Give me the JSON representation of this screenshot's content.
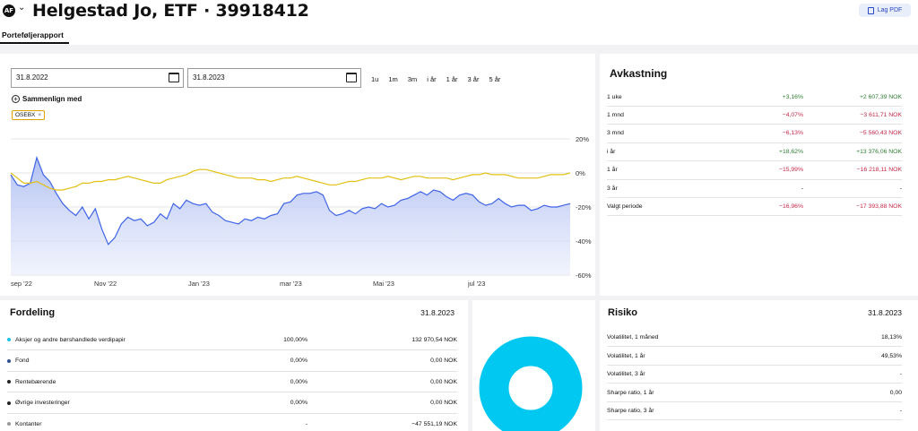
{
  "header": {
    "avatar": "AF",
    "title": "Helgestad Jo, ETF · 39918412",
    "pdf_label": "Lag PDF",
    "tab": "Porteføljerapport"
  },
  "chart": {
    "from_date": "31.8.2022",
    "to_date": "31.8.2023",
    "ranges": [
      "1u",
      "1m",
      "3m",
      "i år",
      "1 år",
      "3 år",
      "5 år"
    ],
    "compare_label": "Sammenlign med",
    "benchmark_chip": "OSEBX"
  },
  "chart_data": {
    "type": "area",
    "x_ticks": [
      "sep '22",
      "Nov '22",
      "Jan '23",
      "mar '23",
      "Mai '23",
      "jul '23"
    ],
    "y_ticks": [
      "20%",
      "0%",
      "-20%",
      "-40%",
      "-60%"
    ],
    "ylim": [
      -60,
      20
    ],
    "grid": true,
    "colors": {
      "portfolio": "#3f64e6",
      "benchmark": "#e2c012"
    },
    "series": [
      {
        "name": "Portefølje",
        "values": [
          -1,
          -7,
          -8,
          -6,
          9,
          -1,
          -5,
          -12,
          -18,
          -22,
          -25,
          -20,
          -27,
          -21,
          -33,
          -42,
          -38,
          -30,
          -26,
          -28,
          -27,
          -31,
          -29,
          -24,
          -27,
          -18,
          -21,
          -16,
          -18,
          -19,
          -18,
          -23,
          -25,
          -28,
          -29,
          -30,
          -27,
          -28,
          -26,
          -27,
          -25,
          -24,
          -18,
          -17,
          -13,
          -12,
          -12,
          -11,
          -13,
          -22,
          -25,
          -24,
          -22,
          -24,
          -21,
          -20,
          -21,
          -18,
          -20,
          -19,
          -16,
          -15,
          -13,
          -11,
          -13,
          -10,
          -11,
          -14,
          -16,
          -13,
          -12,
          -13,
          -17,
          -19,
          -18,
          -15,
          -18,
          -20,
          -19,
          -19,
          -22,
          -21,
          -19,
          -20,
          -20,
          -19,
          -18
        ]
      },
      {
        "name": "OSEBX",
        "values": [
          0,
          -3,
          -6,
          -6,
          -5,
          -7,
          -9,
          -10,
          -10,
          -9,
          -8,
          -6,
          -6,
          -5,
          -5,
          -4,
          -4,
          -3,
          -2,
          -3,
          -4,
          -5,
          -6,
          -6,
          -4,
          -3,
          -2,
          -1,
          1,
          2,
          2,
          1,
          0,
          -1,
          -2,
          -3,
          -3,
          -3,
          -4,
          -4,
          -5,
          -4,
          -3,
          -3,
          -2,
          -3,
          -4,
          -5,
          -6,
          -7,
          -7,
          -6,
          -5,
          -5,
          -4,
          -3,
          -3,
          -3,
          -2,
          -3,
          -4,
          -3,
          -2,
          -2,
          -3,
          -3,
          -3,
          -3,
          -4,
          -3,
          -2,
          -1,
          -1,
          0,
          -1,
          -1,
          -1,
          -2,
          -3,
          -3,
          -3,
          -3,
          -2,
          -1,
          -1,
          -1,
          0
        ]
      }
    ]
  },
  "avkastning": {
    "title": "Avkastning",
    "rows": [
      {
        "label": "1 uke",
        "pct": "+3,16%",
        "nok": "+2 607,39 NOK",
        "trend": "pos"
      },
      {
        "label": "1 mnd",
        "pct": "−4,07%",
        "nok": "−3 611,71 NOK",
        "trend": "neg"
      },
      {
        "label": "3 mnd",
        "pct": "−6,13%",
        "nok": "−5 560,43 NOK",
        "trend": "neg"
      },
      {
        "label": "i år",
        "pct": "+18,62%",
        "nok": "+13 376,06 NOK",
        "trend": "pos"
      },
      {
        "label": "1 år",
        "pct": "−15,99%",
        "nok": "−16 218,11 NOK",
        "trend": "neg"
      },
      {
        "label": "3 år",
        "pct": "-",
        "nok": "-",
        "trend": "none"
      },
      {
        "label": "Valgt periode",
        "pct": "−16,96%",
        "nok": "−17 393,88 NOK",
        "trend": "neg"
      }
    ]
  },
  "fordeling": {
    "title": "Fordeling",
    "date": "31.8.2023",
    "rows": [
      {
        "label": "Aksjer og andre børshandlede verdipapir",
        "pct": "100,00%",
        "nok": "132 970,54 NOK",
        "color": "#19c3ec"
      },
      {
        "label": "Fond",
        "pct": "0,00%",
        "nok": "0,00 NOK",
        "color": "#2f4f8f"
      },
      {
        "label": "Rentebærende",
        "pct": "0,00%",
        "nok": "0,00 NOK",
        "color": "#222222"
      },
      {
        "label": "Øvrige investeringer",
        "pct": "0,00%",
        "nok": "0,00 NOK",
        "color": "#222222"
      },
      {
        "label": "Kontanter",
        "pct": "-",
        "nok": "−47 551,19 NOK",
        "color": "#999999"
      }
    ],
    "donut_color": "#00c8f0"
  },
  "risiko": {
    "title": "Risiko",
    "date": "31.8.2023",
    "rows": [
      {
        "label": "Volatilitet, 1 måned",
        "value": "18,13%"
      },
      {
        "label": "Volatilitet, 1 år",
        "value": "49,53%"
      },
      {
        "label": "Volatilitet, 3 år",
        "value": "-"
      },
      {
        "label": "Sharpe ratio, 1 år",
        "value": "0,00"
      },
      {
        "label": "Sharpe ratio, 3 år",
        "value": "-"
      }
    ]
  }
}
